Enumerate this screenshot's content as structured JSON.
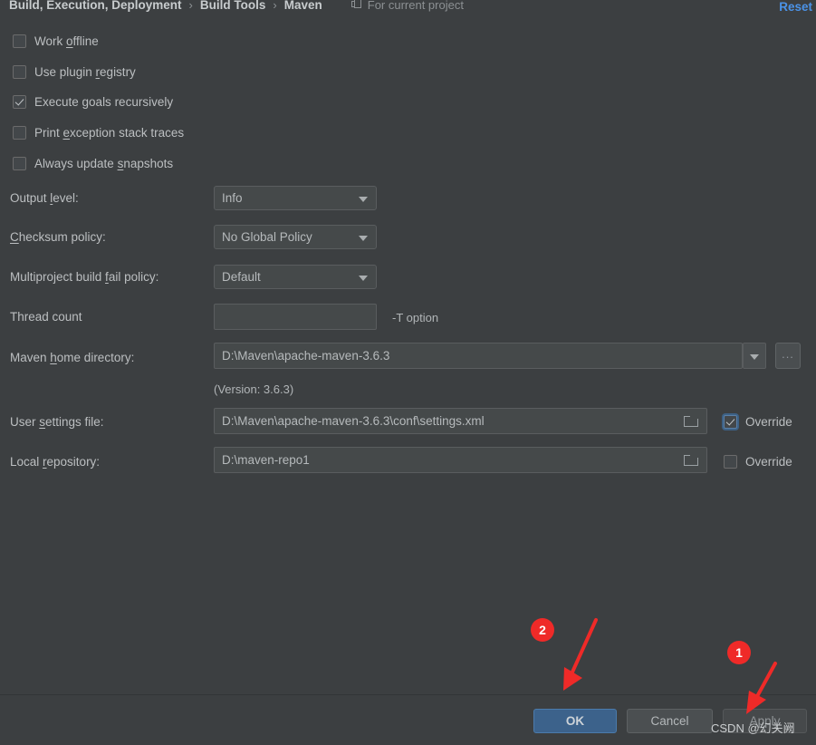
{
  "header": {
    "breadcrumb": [
      "Build, Execution, Deployment",
      "Build Tools",
      "Maven"
    ],
    "separator": "›",
    "scope_label": "For current project",
    "scope_icon": "project-module-icon",
    "reset_label": "Reset",
    "reset_color": "#4b93e8"
  },
  "checkboxes": [
    {
      "label_before": "Work ",
      "mnemonic": "o",
      "label_after": "ffline",
      "checked": false
    },
    {
      "label_before": "Use plugin ",
      "mnemonic": "r",
      "label_after": "egistry",
      "checked": false
    },
    {
      "label_before": "Execute ",
      "mnemonic": "g",
      "label_after": "oals recursively",
      "checked": true
    },
    {
      "label_before": "Print ",
      "mnemonic": "e",
      "label_after": "xception stack traces",
      "checked": false
    },
    {
      "label_before": "Always update ",
      "mnemonic": "s",
      "label_after": "napshots",
      "checked": false
    }
  ],
  "fields": {
    "output_level": {
      "label_before": "Output ",
      "mnemonic": "l",
      "label_after": "evel:",
      "value": "Info",
      "type": "combobox"
    },
    "checksum_policy": {
      "label_before": "",
      "mnemonic": "C",
      "label_after": "hecksum policy:",
      "value": "No Global Policy",
      "type": "combobox"
    },
    "multiproject_fail_policy": {
      "label_before": "Multiproject build ",
      "mnemonic": "f",
      "label_after": "ail policy:",
      "value": "Default",
      "type": "combobox"
    },
    "thread_count": {
      "label_before": "Thread count",
      "mnemonic": "",
      "label_after": "",
      "value": "",
      "note": "-T option",
      "type": "textfield"
    },
    "maven_home": {
      "label_before": "Maven ",
      "mnemonic": "h",
      "label_after": "ome directory:",
      "value": "D:\\Maven\\apache-maven-3.6.3",
      "browse_label": "...",
      "version_note": "(Version: 3.6.3)",
      "type": "editable-combobox"
    },
    "user_settings_file": {
      "label_before": "User ",
      "mnemonic": "s",
      "label_after": "ettings file:",
      "value": "D:\\Maven\\apache-maven-3.6.3\\conf\\settings.xml",
      "override_label": "Override",
      "override_checked": true,
      "type": "textfield-browse"
    },
    "local_repository": {
      "label_before": "Local ",
      "mnemonic": "r",
      "label_after": "epository:",
      "value": "D:\\maven-repo1",
      "override_label": "Override",
      "override_checked": false,
      "type": "textfield-browse"
    }
  },
  "buttons": {
    "ok": "OK",
    "cancel": "Cancel",
    "apply": "Apply"
  },
  "annotations": {
    "badge_1": "1",
    "badge_2": "2",
    "badge_color": "#ef2a28",
    "watermark": "CSDN @幻关阙"
  }
}
